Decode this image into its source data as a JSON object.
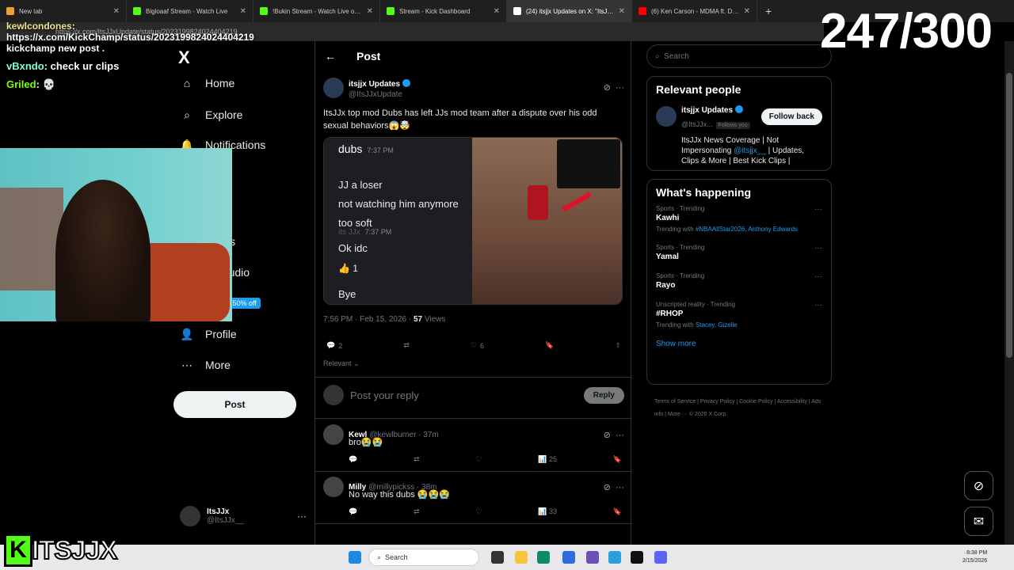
{
  "browser": {
    "tabs": [
      {
        "title": "New tab",
        "color": "#f0a030"
      },
      {
        "title": "Bigloaaf Stream - Watch Live",
        "color": "#53fc18"
      },
      {
        "title": "!Bukin Stream - Watch Live on Kick",
        "color": "#53fc18"
      },
      {
        "title": "Stream - Kick Dashboard",
        "color": "#53fc18"
      },
      {
        "title": "(24) itsjjx Updates on X: \"ItsJJx top",
        "color": "#ffffff"
      },
      {
        "title": "(6) Ken Carson - MDMA ft. Destroy",
        "color": "#ff0000"
      }
    ],
    "url": "https://x.com/ItsJJxUpdate/status/2023199824024404219"
  },
  "overlay_chat": [
    {
      "user": "kewlcondones",
      "msg": "https://x.com/KickChamp/status/2023199824024404219 kickchamp new post ."
    },
    {
      "user": "vBxndo",
      "msg": "check ur clips"
    },
    {
      "user": "Griled",
      "msg": "💀"
    }
  ],
  "counter": "247/300",
  "nav": {
    "logo": "X",
    "items": [
      {
        "label": "Home",
        "icon": "home-icon",
        "glyph": "⌂"
      },
      {
        "label": "Explore",
        "icon": "search-icon",
        "glyph": "⌕"
      },
      {
        "label": "Notifications",
        "icon": "bell-icon",
        "glyph": "🔔"
      },
      {
        "label": "marks",
        "icon": "bookmark-icon",
        "glyph": "🔖"
      },
      {
        "label": "or Studio",
        "icon": "studio-icon",
        "glyph": "▤"
      },
      {
        "label": "um",
        "icon": "premium-icon",
        "glyph": "✕",
        "badge": "50% off"
      },
      {
        "label": "Profile",
        "icon": "profile-icon",
        "glyph": "👤"
      },
      {
        "label": "More",
        "icon": "more-icon",
        "glyph": "⋯"
      }
    ],
    "post_label": "Post",
    "account": {
      "name": "ItsJJx",
      "handle": "@ItsJJx__"
    }
  },
  "post": {
    "header_title": "Post",
    "author": "itsjjx Updates",
    "handle": "@ItsJJxUpdate",
    "text": "ItsJJx top mod Dubs has left JJs mod team after a dispute over his odd sexual behaviors😱🤯",
    "media": {
      "chat_name": "dubs",
      "chat_time": "7:37 PM",
      "lines": [
        "JJ a loser",
        "not watching him anymore",
        "too soft"
      ],
      "reply_name": "its JJx",
      "reply_time": "7:37 PM",
      "reply_text": "Ok idc",
      "reaction": "👍 1",
      "bye": "Bye"
    },
    "timestamp": "7:56 PM · Feb 15, 2026 · ",
    "views_count": "57",
    "views_label": " Views",
    "replies": "2",
    "likes": "6",
    "relevant_label": "Relevant ⌄",
    "reply_placeholder": "Post your reply",
    "reply_button": "Reply"
  },
  "replies": [
    {
      "name": "Kewl",
      "handle": "@kewlburner · 37m",
      "text": "bro😭😭",
      "views": "25"
    },
    {
      "name": "Milly",
      "handle": "@millypickss · 38m",
      "text": "No way this dubs 😭😭😭",
      "views": "33"
    }
  ],
  "sidebar": {
    "search_placeholder": "Search",
    "relevant_title": "Relevant people",
    "person": {
      "name": "itsjjx Updates",
      "handle": "@ItsJJx...",
      "follows": "Follows you",
      "button": "Follow back",
      "bio_pre": "ItsJJx News Coverage | Not Impersonating ",
      "bio_link": "@itsjjx__",
      "bio_post": " | Updates, Clips & More | Best Kick Clips |"
    },
    "happening_title": "What's happening",
    "trends": [
      {
        "cat": "Sports · Trending",
        "title": "Kawhi",
        "with_label": "Trending with ",
        "with": "#NBAAllStar2026, Anthony Edwards"
      },
      {
        "cat": "Sports · Trending",
        "title": "Yamal",
        "with_label": "",
        "with": ""
      },
      {
        "cat": "Sports · Trending",
        "title": "Rayo",
        "with_label": "",
        "with": ""
      },
      {
        "cat": "Unscripted reality · Trending",
        "title": "#RHOP",
        "with_label": "Trending with ",
        "with": "Stacey, Gizelle"
      }
    ],
    "show_more": "Show more",
    "footer": "Terms of Service  |  Privacy Policy  |  Cookie Policy  |  Accessibility  |  Ads info  |  More ···  © 2026 X Corp."
  },
  "taskbar": {
    "search": "Search",
    "time": "8:38 PM",
    "date": "2/15/2026"
  },
  "brand": {
    "k": "K",
    "text": "ITSJJX"
  }
}
